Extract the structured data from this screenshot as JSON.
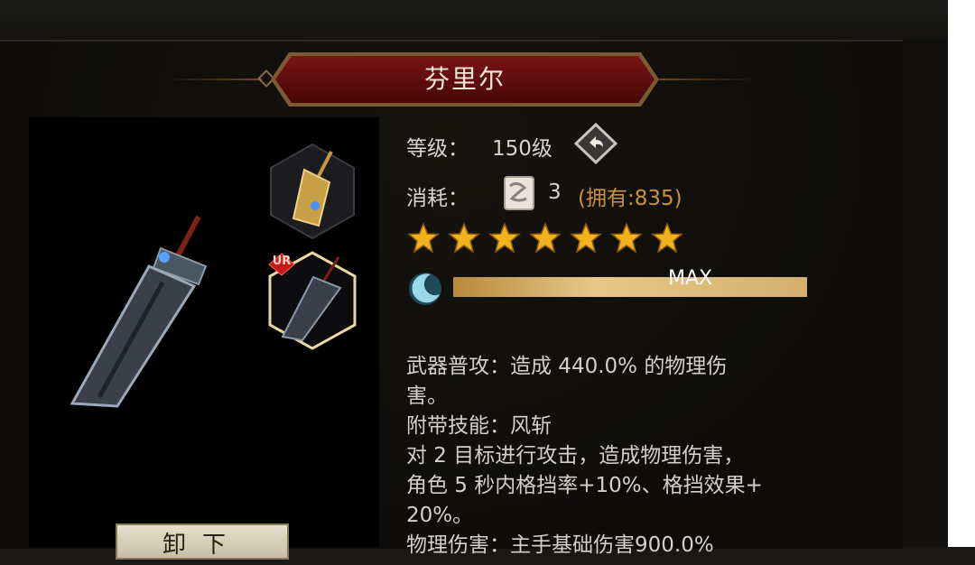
{
  "title": "芬里尔",
  "level": {
    "label": "等级：",
    "value": "150级"
  },
  "cost": {
    "label": "消耗：",
    "amount": "3",
    "owned": "(拥有:835)"
  },
  "stars": {
    "count": 7,
    "color": "#f2b21e"
  },
  "progress": {
    "label": "MAX",
    "fraction": 1.0
  },
  "badge": {
    "rarity": "UR"
  },
  "description": [
    "武器普攻：造成 440.0% 的物理伤",
    "害。",
    "附带技能：风斩",
    "对 2 目标进行攻击，造成物理伤害，",
    "角色 5 秒内格挡率+10%、格挡效果+",
    "20%。",
    "物理伤害：主手基础伤害900.0%"
  ],
  "equip_button": {
    "label": "卸下"
  },
  "icons": [
    "return-icon",
    "scroll-icon",
    "star-icon",
    "moon-icon",
    "sword-icon"
  ],
  "colors": {
    "banner": "#6a1010",
    "gold": "#c8923a",
    "bar": "#d9b46a"
  }
}
